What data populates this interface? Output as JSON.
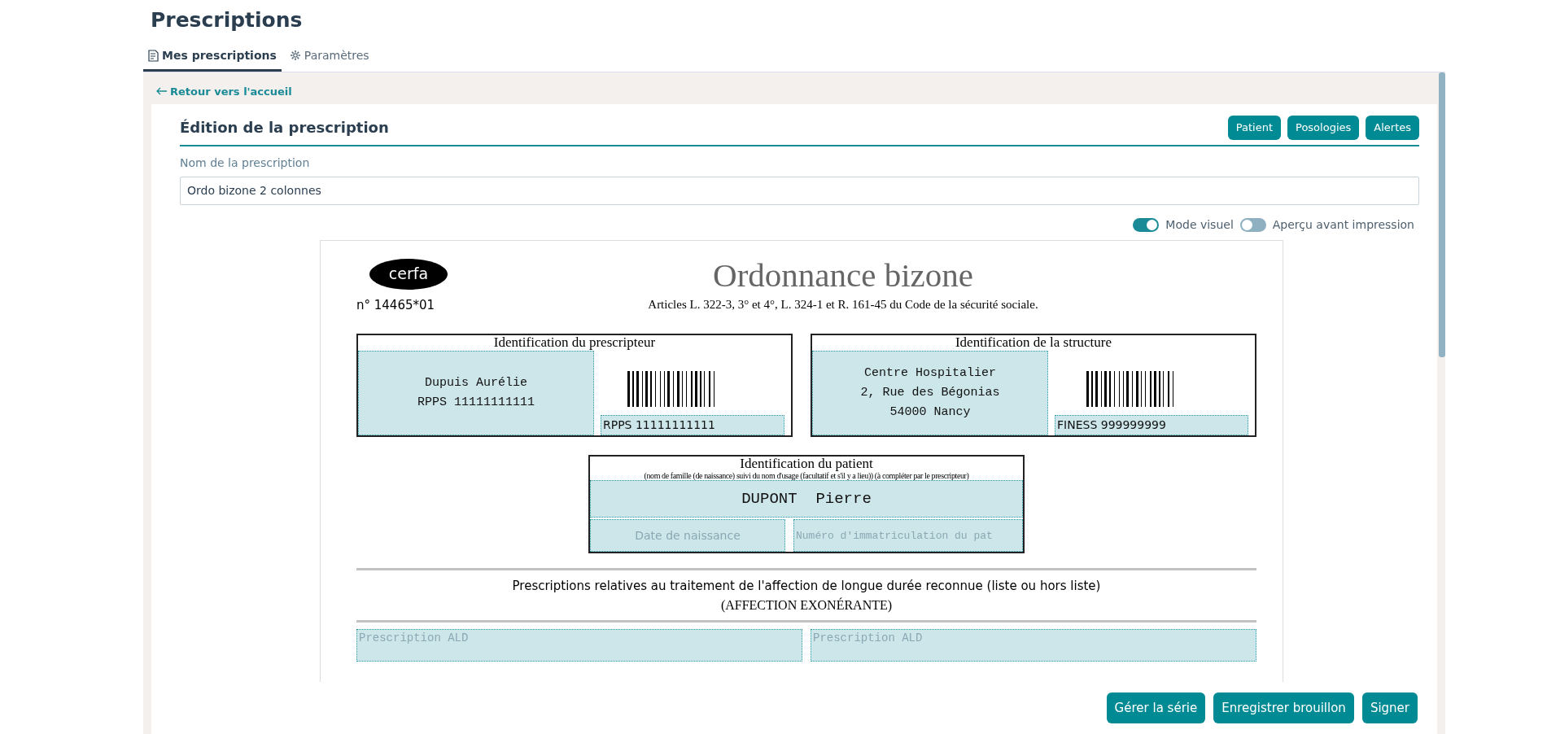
{
  "page": {
    "title": "Prescriptions"
  },
  "tabs": [
    {
      "label": "Mes prescriptions",
      "selected": true
    },
    {
      "label": "Paramètres",
      "selected": false
    }
  ],
  "back_link": "Retour vers l'accueil",
  "editor": {
    "title": "Édition de la prescription",
    "buttons": [
      "Patient",
      "Posologies",
      "Alertes"
    ],
    "name_label": "Nom de la prescription",
    "name_value": "Ordo bizone 2 colonnes",
    "toggles": [
      {
        "label": "Mode visuel",
        "on": true
      },
      {
        "label": "Aperçu avant impression",
        "on": false
      }
    ]
  },
  "document": {
    "logo": "cerfa",
    "form_number": "n° 14465*01",
    "title": "Ordonnance bizone",
    "subtitle": "Articles L. 322-3, 3° et 4°, L. 324-1 et R. 161-45 du Code de la sécurité sociale.",
    "boxes": [
      {
        "title": "Identification du prescripteur",
        "lines": [
          "Dupuis Aurélie",
          "RPPS 11111111111"
        ],
        "barcode_label": "RPPS 11111111111"
      },
      {
        "title": "Identification de la structure",
        "lines": [
          "Centre Hospitalier",
          "2, Rue des Bégonias",
          "54000 Nancy"
        ],
        "barcode_label": "FINESS 999999999"
      }
    ],
    "patient": {
      "title": "Identification du patient",
      "note": "(nom de famille (de naissance) suivi du nom d'usage (facultatif et s'il y a lieu)) (à compléter par le prescripteur)",
      "name": "DUPONT  Pierre",
      "birth_placeholder": "Date de naissance",
      "number_placeholder": "Numéro d'immatriculation du pat"
    },
    "ald": {
      "title": "Prescriptions relatives au traitement de l'affection de longue durée reconnue (liste ou hors liste)",
      "subtitle": "(AFFECTION EXONÉRANTE)",
      "placeholders": [
        "Prescription ALD",
        "Prescription ALD"
      ]
    }
  },
  "footer_buttons": [
    "Gérer la série",
    "Enregistrer brouillon",
    "Signer"
  ]
}
